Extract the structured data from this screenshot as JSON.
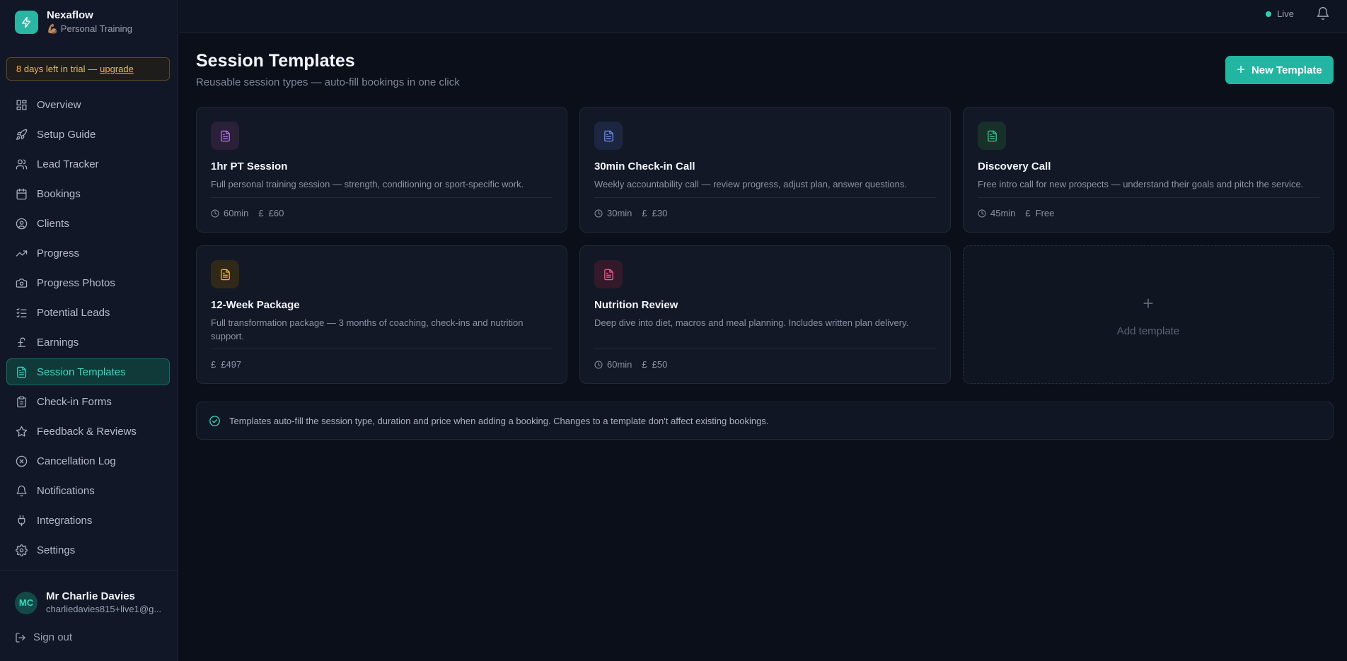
{
  "brand": {
    "name": "Nexaflow",
    "subtitle": "💪🏽 Personal Training"
  },
  "trial": {
    "text": "8 days left in trial —",
    "link": "upgrade"
  },
  "nav": [
    {
      "id": "overview",
      "label": "Overview",
      "icon": "grid-icon"
    },
    {
      "id": "setup-guide",
      "label": "Setup Guide",
      "icon": "rocket-icon"
    },
    {
      "id": "lead-tracker",
      "label": "Lead Tracker",
      "icon": "users-icon"
    },
    {
      "id": "bookings",
      "label": "Bookings",
      "icon": "calendar-icon"
    },
    {
      "id": "clients",
      "label": "Clients",
      "icon": "user-circle-icon"
    },
    {
      "id": "progress",
      "label": "Progress",
      "icon": "trending-up-icon"
    },
    {
      "id": "progress-photos",
      "label": "Progress Photos",
      "icon": "camera-icon"
    },
    {
      "id": "potential-leads",
      "label": "Potential Leads",
      "icon": "checklist-icon"
    },
    {
      "id": "earnings",
      "label": "Earnings",
      "icon": "pound-icon"
    },
    {
      "id": "session-templates",
      "label": "Session Templates",
      "icon": "file-icon",
      "active": true
    },
    {
      "id": "check-in-forms",
      "label": "Check-in Forms",
      "icon": "clipboard-icon"
    },
    {
      "id": "feedback-reviews",
      "label": "Feedback & Reviews",
      "icon": "star-icon"
    },
    {
      "id": "cancellation-log",
      "label": "Cancellation Log",
      "icon": "x-circle-icon"
    },
    {
      "id": "notifications",
      "label": "Notifications",
      "icon": "bell-icon"
    },
    {
      "id": "integrations",
      "label": "Integrations",
      "icon": "plug-icon"
    },
    {
      "id": "settings",
      "label": "Settings",
      "icon": "gear-icon"
    }
  ],
  "user": {
    "initials": "MC",
    "name": "Mr Charlie Davies",
    "email": "charliedavies815+live1@g..."
  },
  "signout": "Sign out",
  "topbar": {
    "status": "Live"
  },
  "page": {
    "title": "Session Templates",
    "subtitle": "Reusable session types — auto-fill bookings in one click",
    "new_button": "New Template"
  },
  "templates": [
    {
      "title": "1hr PT Session",
      "description": "Full personal training session — strength, conditioning or sport-specific work.",
      "duration": "60min",
      "price": "£60",
      "accent": "#b57bef",
      "accent_bg": "#2a2038"
    },
    {
      "title": "30min Check-in Call",
      "description": "Weekly accountability call — review progress, adjust plan, answer questions.",
      "duration": "30min",
      "price": "£30",
      "accent": "#6e8ff5",
      "accent_bg": "#1d2640"
    },
    {
      "title": "Discovery Call",
      "description": "Free intro call for new prospects — understand their goals and pitch the service.",
      "duration": "45min",
      "price": "Free",
      "accent": "#3ecf8e",
      "accent_bg": "#17302a"
    },
    {
      "title": "12-Week Package",
      "description": "Full transformation package — 3 months of coaching, check-ins and nutrition support.",
      "duration": "",
      "price": "£497",
      "accent": "#f2b544",
      "accent_bg": "#302818"
    },
    {
      "title": "Nutrition Review",
      "description": "Deep dive into diet, macros and meal planning. Includes written plan delivery.",
      "duration": "60min",
      "price": "£50",
      "accent": "#ef5f8e",
      "accent_bg": "#33192a"
    }
  ],
  "add_template": "Add template",
  "info": "Templates auto-fill the session type, duration and price when adding a booking. Changes to a template don't affect existing bookings.",
  "colors": {
    "accent": "#22b6a2",
    "background": "#0b0f1a",
    "sidebar": "#111726"
  }
}
